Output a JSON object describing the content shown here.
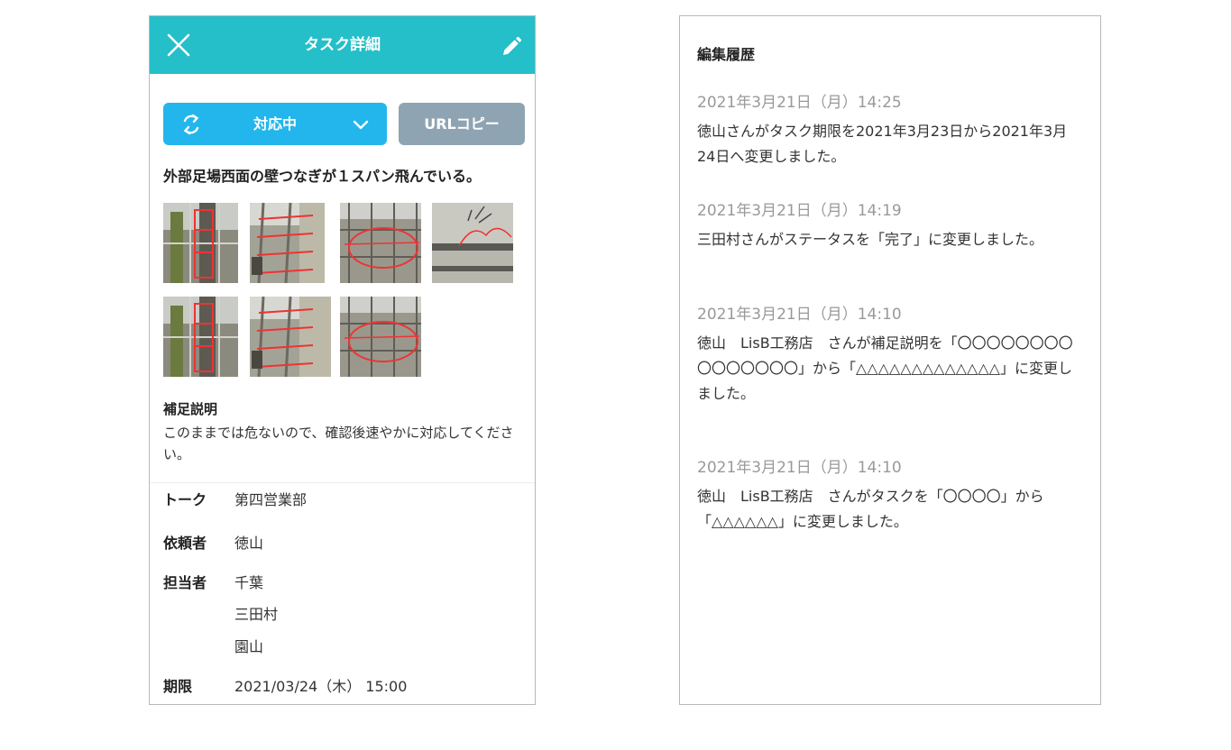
{
  "task_detail": {
    "header_title": "タスク詳細",
    "status_label": "対応中",
    "url_copy_label": "URLコピー",
    "task_title": "外部足場西面の壁つなぎが１スパン飛んでいる。",
    "photo_count": 7,
    "note_heading": "補足説明",
    "note_body": "このままでは危ないので、確認後速やかに対応してください。",
    "fields": {
      "talk_label": "トーク",
      "talk_value": "第四営業部",
      "requester_label": "依頼者",
      "requester_value": "徳山",
      "assignee_label": "担当者",
      "assignees": [
        "千葉",
        "三田村",
        "園山"
      ],
      "deadline_label": "期限",
      "deadline_value": "2021/03/24（木） 15:00"
    },
    "colors": {
      "header": "#24bfc9",
      "status_button": "#23b6ec",
      "url_button": "#8fa4b3"
    }
  },
  "history": {
    "title": "編集履歴",
    "entries": [
      {
        "timestamp": "2021年3月21日（月）14:25",
        "message": "徳山さんがタスク期限を2021年3月23日から2021年3月24日へ変更しました。"
      },
      {
        "timestamp": "2021年3月21日（月）14:19",
        "message": "三田村さんがステータスを「完了」に変更しました。"
      },
      {
        "timestamp": "2021年3月21日（月）14:10",
        "message": "徳山　LisB工務店　さんが補足説明を「〇〇〇〇〇〇〇〇〇〇〇〇〇〇〇」から「△△△△△△△△△△△△△」に変更しました。"
      },
      {
        "timestamp": "2021年3月21日（月）14:10",
        "message": "徳山　LisB工務店　さんがタスクを「〇〇〇〇」から「△△△△△△」に変更しました。"
      }
    ]
  }
}
